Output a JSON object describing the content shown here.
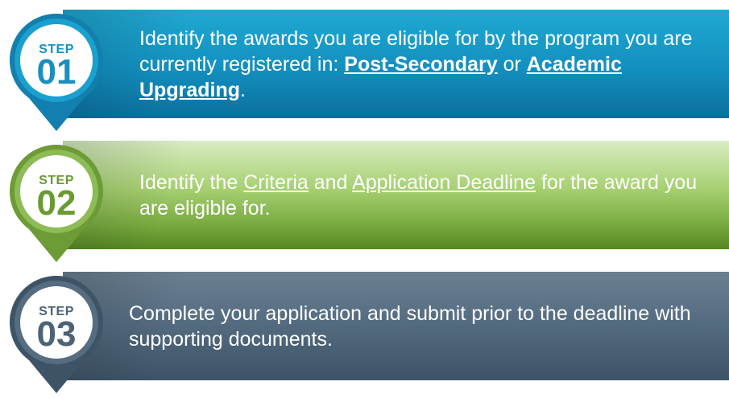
{
  "colors": {
    "step1_accent": "#1a8fc0",
    "step2_accent": "#6a9a32",
    "step3_accent": "#4c6277"
  },
  "steps": [
    {
      "label": "STEP",
      "number": "01",
      "text_before": "Identify the awards you are eligible for by the program you are currently registered in: ",
      "link1": "Post-Secondary",
      "text_middle": " or ",
      "link2": "Academic Upgrading",
      "text_after": "."
    },
    {
      "label": "STEP",
      "number": "02",
      "text_before": "Identify the ",
      "link1": "Criteria",
      "text_middle": " and ",
      "link2": "Application Deadline",
      "text_after": " for the award you are eligible for."
    },
    {
      "label": "STEP",
      "number": "03",
      "text": "Complete your application and submit prior to the deadline with supporting documents."
    }
  ]
}
